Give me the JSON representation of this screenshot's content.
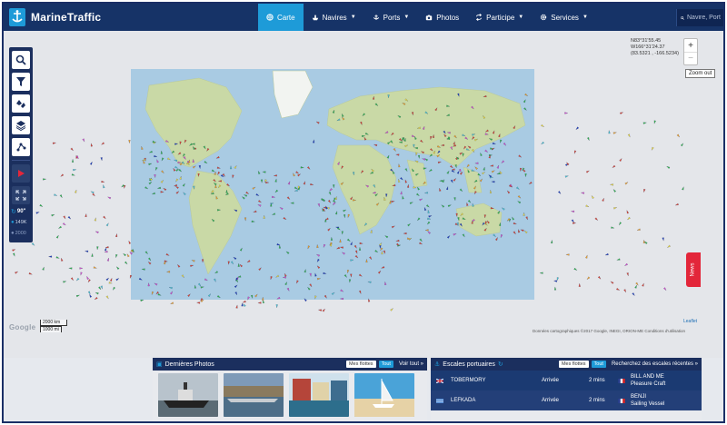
{
  "app": {
    "name": "MarineTraffic"
  },
  "nav": {
    "items": [
      {
        "label": "Carte",
        "caret": false
      },
      {
        "label": "Navires",
        "caret": true
      },
      {
        "label": "Ports",
        "caret": true
      },
      {
        "label": "Photos",
        "caret": false
      },
      {
        "label": "Participe",
        "caret": true
      },
      {
        "label": "Services",
        "caret": true
      }
    ],
    "active": "Carte"
  },
  "search": {
    "placeholder": "Navire, Port"
  },
  "map": {
    "coords": [
      "N83°31'55.45",
      "W166°31'24.37",
      "(83.5321 , -166.5234)"
    ],
    "zoom_in": "+",
    "zoom_out": "−",
    "zoom_tooltip": "Zoom out",
    "refresh_label": "90\"",
    "vessel_count": "149K",
    "vessel_total": "2000",
    "news_tab": "News",
    "google_logo": "Google",
    "scale": [
      "2000 km",
      "1000 mi"
    ],
    "attribution": "Données cartographiques ©2017 Google, INEGI, ORION-ME    Conditions d'utilisation",
    "leaflet": "Leaflet",
    "colors": {
      "cargo": "#2dbb4b",
      "tanker": "#e0432f",
      "passenger": "#1b3fc0",
      "fishing": "#f5a623",
      "pleasure": "#d94fd1",
      "high_speed": "#f2e23a",
      "tug": "#46c9d6"
    }
  },
  "photos": {
    "title": "Dernières Photos",
    "filter_mine": "Mes flottes",
    "filter_all": "Tout",
    "view_all": "Voir tout »"
  },
  "ports": {
    "title": "Escales portuaires",
    "filter_mine": "Mes flottes",
    "filter_all": "Tout",
    "search_link": "Recherchez des escales récentes »",
    "rows": [
      {
        "port": "TOBERMORY",
        "event": "Arrivée",
        "time": "2 mins",
        "vessel": "BILL AND ME",
        "type": "Pleasure Craft"
      },
      {
        "port": "LEFKADA",
        "event": "Arrivée",
        "time": "2 mins",
        "vessel": "BENJI",
        "type": "Sailing Vessel"
      }
    ]
  }
}
